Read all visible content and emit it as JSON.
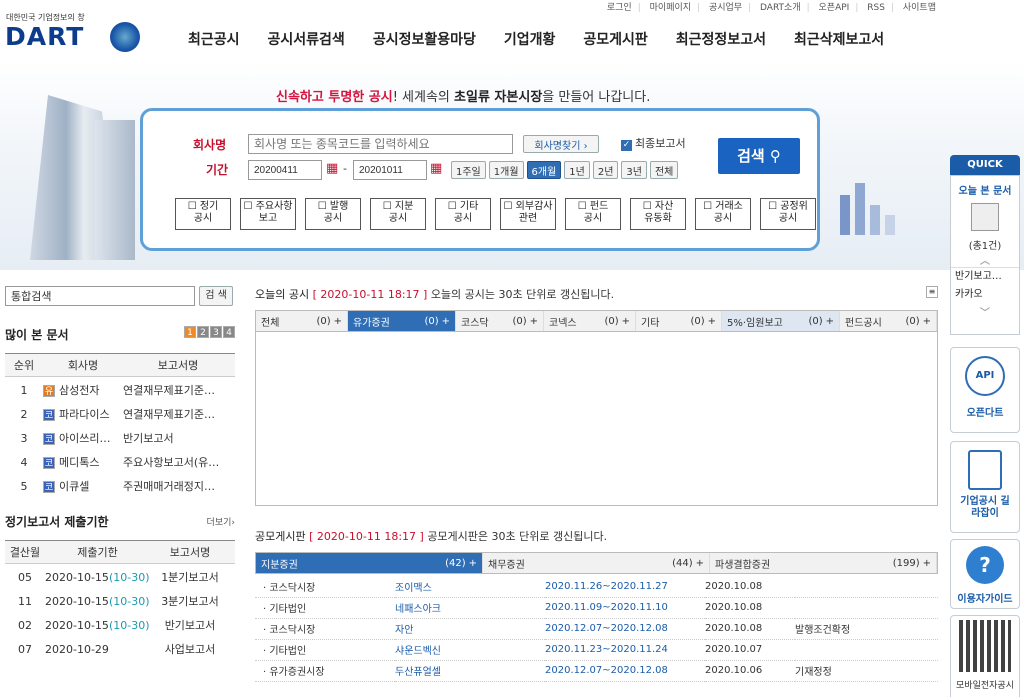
{
  "top_links": [
    "로그인",
    "마이페이지",
    "공시업무",
    "DART소개",
    "오픈API",
    "RSS",
    "사이트맵"
  ],
  "logo": {
    "small": "대한민국 기업정보의 창",
    "main": "DART"
  },
  "gnb": [
    "최근공시",
    "공시서류검색",
    "공시정보활용마당",
    "기업개황",
    "공모게시판",
    "최근정정보고서",
    "최근삭제보고서"
  ],
  "slogan": {
    "part1": "신속하고 투명한 공시",
    "part2": "! 세계속의 ",
    "part3": "초일류 자본시장",
    "part4": "을 만들어 나갑니다."
  },
  "search": {
    "company_label": "회사명",
    "company_placeholder": "회사명 또는 종목코드를 입력하세요",
    "find_btn": "회사명찾기 ›",
    "final_label": "최종보고서",
    "period_label": "기간",
    "start": "20200411",
    "end": "20201011",
    "periods": [
      "1주일",
      "1개월",
      "6개월",
      "1년",
      "2년",
      "3년",
      "전체"
    ],
    "active_period": "6개월",
    "submit": "검색",
    "categories": [
      [
        "정기",
        "공시"
      ],
      [
        "주요사항",
        "보고"
      ],
      [
        "발행",
        "공시"
      ],
      [
        "지분",
        "공시"
      ],
      [
        "기타",
        "공시"
      ],
      [
        "외부감사",
        "관련"
      ],
      [
        "펀드",
        "공시"
      ],
      [
        "자산",
        "유동화"
      ],
      [
        "거래소",
        "공시"
      ],
      [
        "공정위",
        "공시"
      ]
    ]
  },
  "quick": {
    "title": "QUICK",
    "today_doc": "오늘 본 문서",
    "count": "(총1건)",
    "doc1": "반기보고…",
    "doc2": "카카오",
    "openapi": "오픈다트",
    "guide": "기업공시 길라잡이",
    "help": "이용자가이드",
    "mobile": "모바일전자공시"
  },
  "left": {
    "search_placeholder": "통합검색",
    "search_btn": "검 색",
    "popular_title": "많이 본 문서",
    "pages": [
      "1",
      "2",
      "3",
      "4"
    ],
    "popular_headers": [
      "순위",
      "회사명",
      "보고서명"
    ],
    "popular": [
      {
        "rank": "1",
        "badge": "유",
        "badge_color": "#e07b26",
        "company": "삼성전자",
        "report": "연결재무제표기준…"
      },
      {
        "rank": "2",
        "badge": "코",
        "badge_color": "#3b63b8",
        "company": "파라다이스",
        "report": "연결재무제표기준…"
      },
      {
        "rank": "3",
        "badge": "코",
        "badge_color": "#3b63b8",
        "company": "아이쓰리…",
        "report": "반기보고서"
      },
      {
        "rank": "4",
        "badge": "코",
        "badge_color": "#3b63b8",
        "company": "메디톡스",
        "report": "주요사항보고서(유…"
      },
      {
        "rank": "5",
        "badge": "코",
        "badge_color": "#3b63b8",
        "company": "이큐셀",
        "report": "주권매매거래정지…"
      }
    ],
    "deadline_title": "정기보고서 제출기한",
    "more": "더보기›",
    "deadline_headers": [
      "결산월",
      "제출기한",
      "보고서명"
    ],
    "deadlines": [
      {
        "month": "05",
        "date": "2020-10-15",
        "extra": "(10-30)",
        "report": "1분기보고서"
      },
      {
        "month": "11",
        "date": "2020-10-15",
        "extra": "(10-30)",
        "report": "3분기보고서"
      },
      {
        "month": "02",
        "date": "2020-10-15",
        "extra": "(10-30)",
        "report": "반기보고서"
      },
      {
        "month": "07",
        "date": "2020-10-29",
        "extra": "",
        "report": "사업보고서"
      }
    ]
  },
  "today": {
    "title": "오늘의 공시",
    "time": "[ 2020-10-11 18:17 ]",
    "note": "오늘의 공시는 30초 단위로 갱신됩니다.",
    "tabs": [
      [
        "전체",
        "(0)"
      ],
      [
        "유가증권",
        "(0)"
      ],
      [
        "코스닥",
        "(0)"
      ],
      [
        "코넥스",
        "(0)"
      ],
      [
        "기타",
        "(0)"
      ],
      [
        "5%·임원보고",
        "(0)"
      ],
      [
        "펀드공시",
        "(0)"
      ]
    ]
  },
  "ipo": {
    "title": "공모게시판",
    "time": "[ 2020-10-11 18:17 ]",
    "note": "공모게시판은 30초 단위로 갱신됩니다.",
    "tabs": [
      [
        "지분증권",
        "(42)"
      ],
      [
        "채무증권",
        "(44)"
      ],
      [
        "파생결합증권",
        "(199)"
      ]
    ],
    "rows": [
      {
        "market": "· 코스닥시장",
        "company": "조이맥스",
        "period": "2020.11.26~2020.11.27",
        "date": "2020.10.08",
        "note": ""
      },
      {
        "market": "· 기타법인",
        "company": "네패스아크",
        "period": "2020.11.09~2020.11.10",
        "date": "2020.10.08",
        "note": ""
      },
      {
        "market": "· 코스닥시장",
        "company": "자안",
        "period": "2020.12.07~2020.12.08",
        "date": "2020.10.08",
        "note": "발행조건확정"
      },
      {
        "market": "· 기타법인",
        "company": "샤운드벡신",
        "period": "2020.11.23~2020.11.24",
        "date": "2020.10.07",
        "note": ""
      },
      {
        "market": "· 유가증권시장",
        "company": "두산퓨얼셀",
        "period": "2020.12.07~2020.12.08",
        "date": "2020.10.06",
        "note": "기재정정"
      }
    ]
  }
}
